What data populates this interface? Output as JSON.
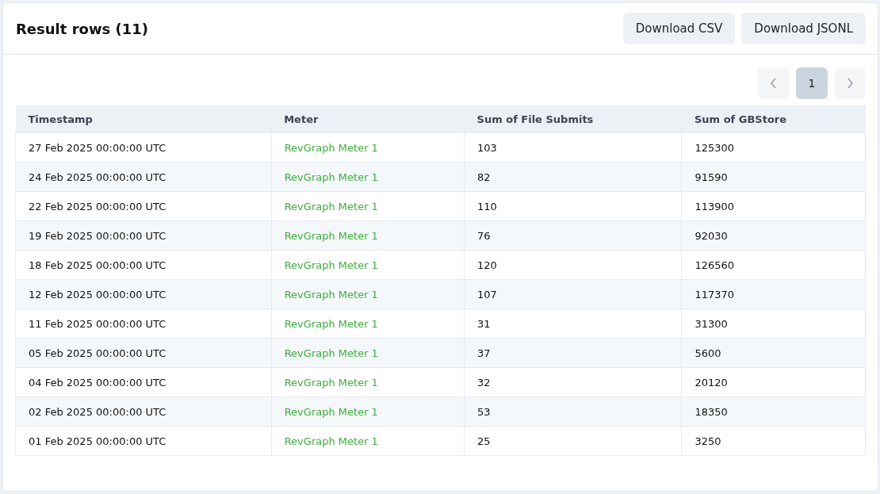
{
  "title": "Result rows (11)",
  "buttons": [
    {
      "label": "Download CSV"
    },
    {
      "label": "Download JSONL"
    }
  ],
  "pagination": {
    "pages": [
      {
        "label": "1",
        "selected": true
      }
    ]
  },
  "table": {
    "columns": [
      "Timestamp",
      "Meter",
      "Sum of File Submits",
      "Sum of GBStore"
    ],
    "rows": [
      [
        "27 Feb 2025 00:00:00 UTC",
        "RevGraph Meter 1",
        "103",
        "125300"
      ],
      [
        "24 Feb 2025 00:00:00 UTC",
        "RevGraph Meter 1",
        "82",
        "91590"
      ],
      [
        "22 Feb 2025 00:00:00 UTC",
        "RevGraph Meter 1",
        "110",
        "113900"
      ],
      [
        "19 Feb 2025 00:00:00 UTC",
        "RevGraph Meter 1",
        "76",
        "92030"
      ],
      [
        "18 Feb 2025 00:00:00 UTC",
        "RevGraph Meter 1",
        "120",
        "126560"
      ],
      [
        "12 Feb 2025 00:00:00 UTC",
        "RevGraph Meter 1",
        "107",
        "117370"
      ],
      [
        "11 Feb 2025 00:00:00 UTC",
        "RevGraph Meter 1",
        "31",
        "31300"
      ],
      [
        "05 Feb 2025 00:00:00 UTC",
        "RevGraph Meter 1",
        "37",
        "5600"
      ],
      [
        "04 Feb 2025 00:00:00 UTC",
        "RevGraph Meter 1",
        "32",
        "20120"
      ],
      [
        "02 Feb 2025 00:00:00 UTC",
        "RevGraph Meter 1",
        "53",
        "18350"
      ],
      [
        "01 Feb 2025 00:00:00 UTC",
        "RevGraph Meter 1",
        "25",
        "3250"
      ]
    ]
  }
}
